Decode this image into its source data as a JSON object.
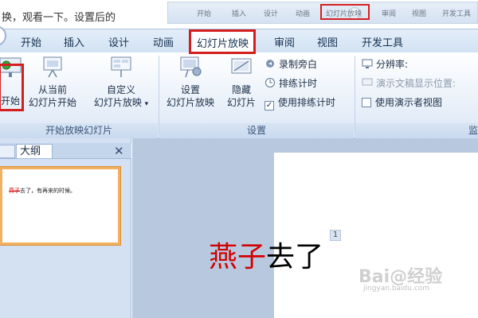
{
  "caption": {
    "text": "换，观看一下。设置后的"
  },
  "inset": {
    "tabs": [
      "开始",
      "插入",
      "设计",
      "动画",
      "幻灯片放映",
      "审阅",
      "视图",
      "开发工具"
    ]
  },
  "tabs": [
    {
      "label": "开始"
    },
    {
      "label": "插入"
    },
    {
      "label": "设计"
    },
    {
      "label": "动画"
    },
    {
      "label": "幻灯片放映",
      "active": true
    },
    {
      "label": "审阅"
    },
    {
      "label": "视图"
    },
    {
      "label": "开发工具"
    }
  ],
  "ribbon": {
    "group_start": {
      "label": "开始放映幻灯片",
      "btn_from_beginning": "开始",
      "btn_from_current_1": "从当前",
      "btn_from_current_2": "幻灯片开始",
      "btn_custom_1": "自定义",
      "btn_custom_2": "幻灯片放映",
      "dropdown_arrow": "▾"
    },
    "group_setup": {
      "label": "设置",
      "btn_setup_1": "设置",
      "btn_setup_2": "幻灯片放映",
      "btn_hide_1": "隐藏",
      "btn_hide_2": "幻灯片",
      "record_narration": "录制旁白",
      "rehearse_timings": "排练计时",
      "use_timings": "使用排练计时",
      "use_timings_checked": true
    },
    "group_monitors": {
      "label_fragment": "监",
      "resolution": "分辨率:",
      "show_on": "演示文稿显示位置:",
      "presenter_view": "使用演示者视图"
    }
  },
  "left_pane": {
    "tab_outline": "大纲",
    "close_glyph": "✕",
    "thumbnail": {
      "highlight": "燕子",
      "rest": "去了，有再来的时候。"
    }
  },
  "slide": {
    "number": "1",
    "text_red": "燕子",
    "text_black": "去了"
  },
  "watermark": {
    "main": "Bai@经验",
    "sub": "jingyan.baidu.com"
  },
  "colors": {
    "highlight_red": "#d41f1f",
    "ribbon_blue": "#d2e2f4",
    "slide_red": "#d20000"
  }
}
